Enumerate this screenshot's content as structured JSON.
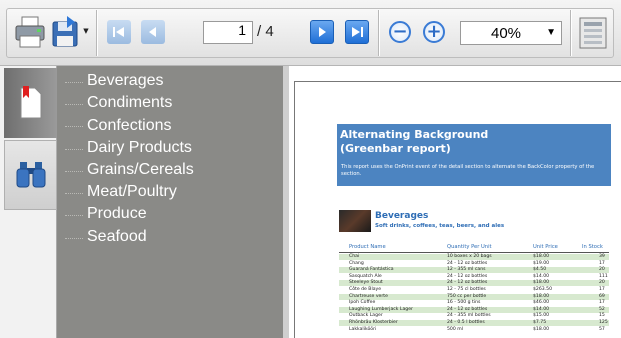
{
  "toolbar": {
    "page_current": "1",
    "page_total": "/ 4",
    "zoom": "40%"
  },
  "outline": {
    "items": [
      "Beverages",
      "Condiments",
      "Confections",
      "Dairy Products",
      "Grains/Cereals",
      "Meat/Poultry",
      "Produce",
      "Seafood"
    ]
  },
  "report": {
    "title_line1": "Alternating Background",
    "title_line2": "(Greenbar report)",
    "description": "This report uses the OnPrint event of the detail section to alternate the BackColor property of the section.",
    "category_title": "Beverages",
    "category_desc": "Soft drinks, coffees, teas, beers, and ales",
    "columns": [
      "Product Name",
      "Quantity Per Unit",
      "Unit Price",
      "In Stock"
    ],
    "rows": [
      [
        "Chai",
        "10 boxes x 20 bags",
        "$18.00",
        "39"
      ],
      [
        "Chang",
        "24 - 12 oz bottles",
        "$19.00",
        "17"
      ],
      [
        "Guaraná Fantástica",
        "12 - 355 ml cans",
        "$4.50",
        "20"
      ],
      [
        "Sasquatch Ale",
        "24 - 12 oz bottles",
        "$14.00",
        "111"
      ],
      [
        "Steeleye Stout",
        "24 - 12 oz bottles",
        "$18.00",
        "20"
      ],
      [
        "Côte de Blaye",
        "12 - 75 cl bottles",
        "$263.50",
        "17"
      ],
      [
        "Chartreuse verte",
        "750 cc per bottle",
        "$18.00",
        "69"
      ],
      [
        "Ipoh Coffee",
        "16 - 500 g tins",
        "$46.00",
        "17"
      ],
      [
        "Laughing Lumberjack Lager",
        "24 - 12 oz bottles",
        "$14.00",
        "52"
      ],
      [
        "Outback Lager",
        "24 - 355 ml bottles",
        "$15.00",
        "15"
      ],
      [
        "Rhönbräu Klosterbier",
        "24 - 0.5 l bottles",
        "$7.75",
        "125"
      ],
      [
        "Lakkalikööri",
        "500 ml",
        "$18.00",
        "57"
      ]
    ]
  }
}
